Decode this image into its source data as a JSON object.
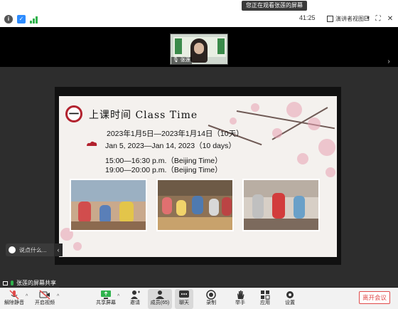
{
  "banner": {
    "text": "您正在观看张莲的屏幕"
  },
  "titlebar": {
    "timer": "41:25",
    "view_label": "演讲者视图",
    "icons": [
      "info-icon",
      "shield-icon",
      "signal-icon",
      "grid-icon",
      "fullscreen-icon",
      "close-icon"
    ]
  },
  "camera": {
    "name": "张莲"
  },
  "slide": {
    "number": "一",
    "title": "上课时间 Class Time",
    "date_cn": "2023年1月5日—2023年1月14日（10天）",
    "date_en": "Jan 5, 2023—Jan 14, 2023（10 days）",
    "time1": "15:00—16:30 p.m.（Beijing Time）",
    "time2": "19:00—20:00 p.m.（Beijing Time）",
    "colors": {
      "accent": "#b2222e",
      "blossom": "#e8a0b2"
    }
  },
  "chat": {
    "placeholder": "说点什么..."
  },
  "share_label": "张莲的屏幕共享",
  "toolbar": {
    "unmute": "解除静音",
    "video": "开启视频",
    "share": "共享屏幕",
    "invite": "邀请",
    "members": "成员(65)",
    "chat": "聊天",
    "record": "录制",
    "raise_hand": "举手",
    "apps": "应用",
    "settings": "设置",
    "leave": "离开会议"
  }
}
